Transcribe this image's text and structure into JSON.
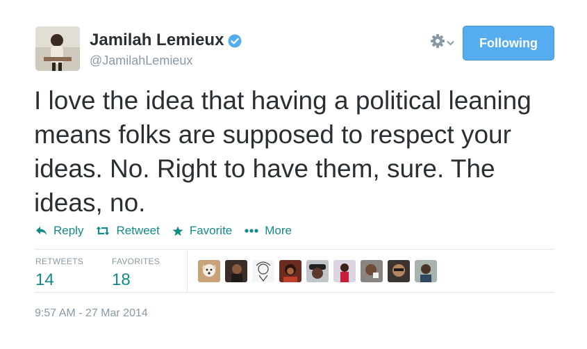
{
  "profile": {
    "name": "Jamilah Lemieux",
    "handle": "@JamilahLemieux",
    "verified_icon": "verified-badge-icon"
  },
  "header": {
    "settings_icon": "gear-icon",
    "follow_button_label": "Following"
  },
  "tweet": {
    "text": "I love the idea that having a political leaning means folks are supposed to respect your ideas. No. Right to have them, sure. The ideas, no."
  },
  "actions": {
    "reply": "Reply",
    "retweet": "Retweet",
    "favorite": "Favorite",
    "more": "More"
  },
  "stats": {
    "retweets_label": "RETWEETS",
    "retweets_value": "14",
    "favorites_label": "FAVORITES",
    "favorites_value": "18"
  },
  "favoriters_count": 9,
  "timestamp": "9:57 AM - 27 Mar 2014",
  "colors": {
    "accent": "#138a8a",
    "button": "#55acee",
    "verified": "#55acee",
    "muted": "#8899a6",
    "text": "#292f33"
  }
}
